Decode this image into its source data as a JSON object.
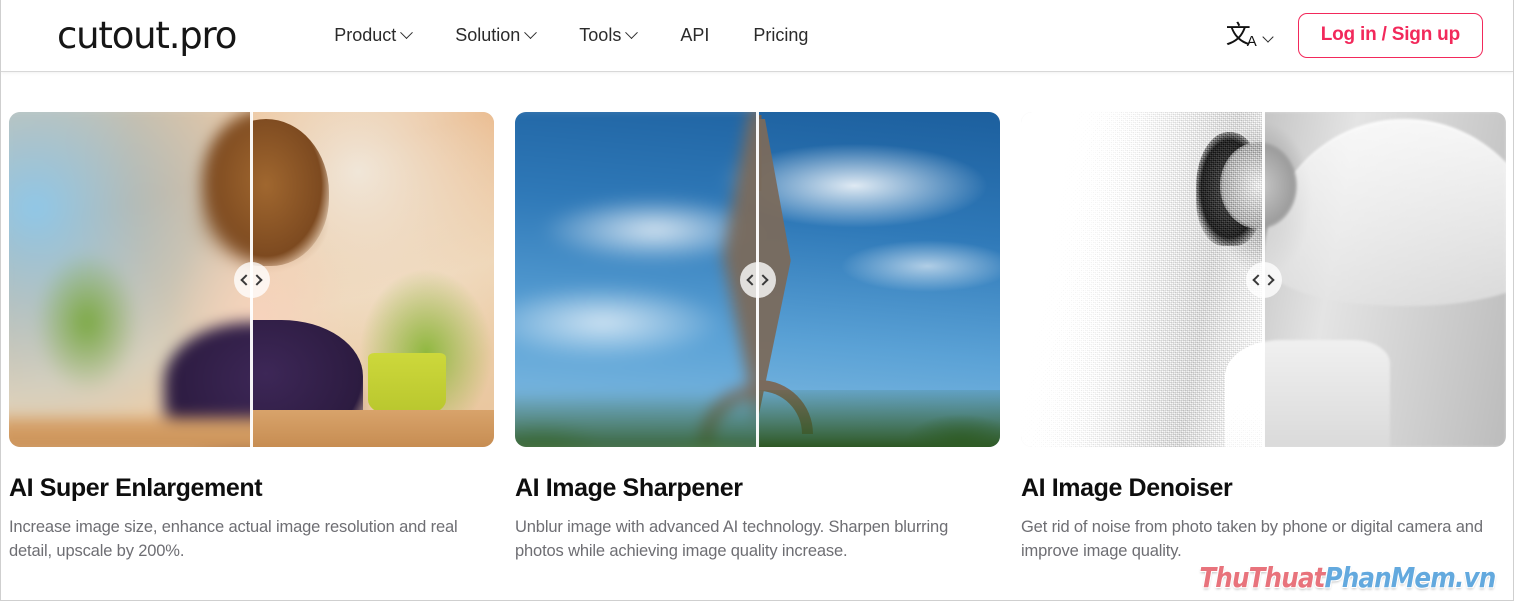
{
  "header": {
    "logo": "cutout.pro",
    "nav": [
      {
        "label": "Product",
        "has_dropdown": true
      },
      {
        "label": "Solution",
        "has_dropdown": true
      },
      {
        "label": "Tools",
        "has_dropdown": true
      },
      {
        "label": "API",
        "has_dropdown": false
      },
      {
        "label": "Pricing",
        "has_dropdown": false
      }
    ],
    "language": {
      "glyph": "文",
      "sub": "A",
      "icon_name": "translate-icon"
    },
    "login_label": "Log in / Sign up",
    "accent_color": "#f2295b"
  },
  "cards": [
    {
      "title": "AI Super Enlargement",
      "desc": "Increase image size, enhance actual image resolution and real detail, upscale by 200%.",
      "image_alt": "young girl resting chin on hands, before and after enlargement",
      "slider_icon": "left-right-arrows-icon"
    },
    {
      "title": "AI Image Sharpener",
      "desc": "Unblur image with advanced AI technology. Sharpen blurring photos while achieving image quality increase.",
      "image_alt": "Eiffel Tower against blue sky, before and after sharpening",
      "slider_icon": "left-right-arrows-icon"
    },
    {
      "title": "AI Image Denoiser",
      "desc": "Get rid of noise from photo taken by phone or digital camera and improve image quality.",
      "image_alt": "black and white photo of woman with transparent umbrella, before and after denoising",
      "slider_icon": "left-right-arrows-icon"
    }
  ],
  "watermark": {
    "part1": "ThuThuat",
    "part2": "PhanMem.vn",
    "color1": "#e8737c",
    "color2": "#63a9de"
  }
}
